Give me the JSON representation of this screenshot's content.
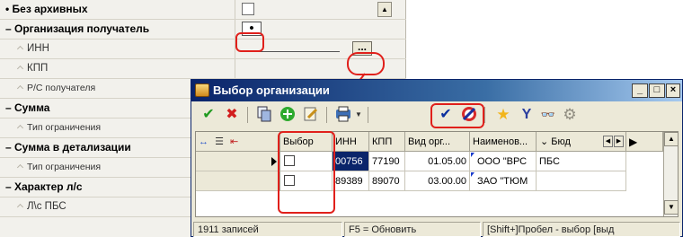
{
  "property_grid": {
    "rows": [
      {
        "label": "Без архивных",
        "kind": "cat"
      },
      {
        "label": "Организация получатель",
        "kind": "cat"
      },
      {
        "label": "ИНН",
        "kind": "sub"
      },
      {
        "label": "КПП",
        "kind": "sub"
      },
      {
        "label": "Р/С получателя",
        "kind": "sub"
      },
      {
        "label": "Сумма",
        "kind": "cat"
      },
      {
        "label": "Тип ограничения",
        "kind": "sub"
      },
      {
        "label": "Сумма в детализации",
        "kind": "cat"
      },
      {
        "label": "Тип ограничения",
        "kind": "sub"
      },
      {
        "label": "Характер л/с",
        "kind": "cat"
      },
      {
        "label": "Л\\с ПБС",
        "kind": "sub"
      }
    ],
    "radio_value": "•",
    "ellipsis_label": "...",
    "scroll_up_glyph": "▲"
  },
  "dialog": {
    "title": "Выбор организации",
    "window_buttons": {
      "minimize": "_",
      "maximize": "□",
      "close": "×"
    },
    "toolbar": {
      "ok_glyph": "✔",
      "cancel_glyph": "✖",
      "check_glyph": "✔",
      "filter_glyph": "Y",
      "search_glyph": "👓"
    },
    "table": {
      "columns": [
        "Выбор",
        "ИНН",
        "КПП",
        "Вид орг...",
        "Наименов...",
        "Бюд"
      ],
      "rows": [
        {
          "inn": "00756",
          "kpp": "77190",
          "vid": "01.05.00",
          "name": "ООО \"ВРС",
          "bud": "ПБС",
          "selected_inn": true
        },
        {
          "inn": "89389",
          "kpp": "89070",
          "vid": "03.00.00",
          "name": "ЗАО \"ТЮМ",
          "bud": "",
          "selected_inn": false
        }
      ]
    },
    "status": {
      "count": "1911 записей",
      "refresh": "F5 = Обновить",
      "hint": "[Shift+]Пробел - выбор [выд"
    }
  },
  "colors": {
    "highlight": "#e0201b",
    "selection": "#0a246a",
    "title_start": "#0a246a"
  }
}
